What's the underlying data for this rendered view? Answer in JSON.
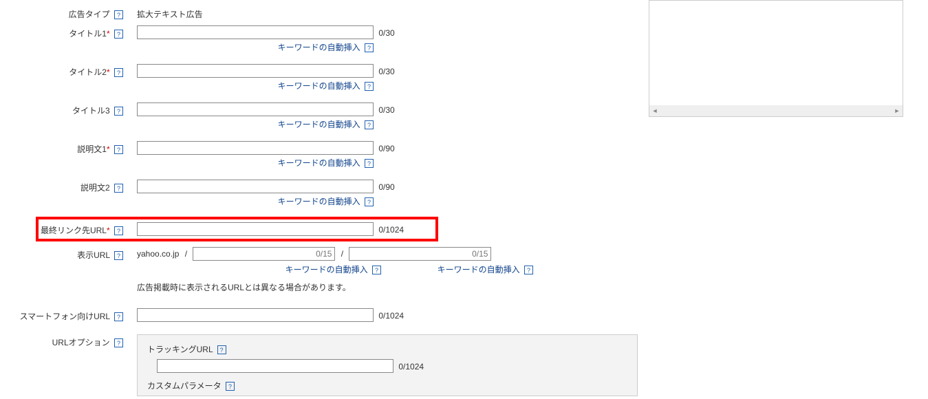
{
  "help_glyph": "?",
  "ad_type": {
    "label": "広告タイプ",
    "value": "拡大テキスト広告"
  },
  "title1": {
    "label": "タイトル1",
    "counter": "0/30",
    "kw_link": "キーワードの自動挿入"
  },
  "title2": {
    "label": "タイトル2",
    "counter": "0/30",
    "kw_link": "キーワードの自動挿入"
  },
  "title3": {
    "label": "タイトル3",
    "counter": "0/30",
    "kw_link": "キーワードの自動挿入"
  },
  "desc1": {
    "label": "説明文1",
    "counter": "0/90",
    "kw_link": "キーワードの自動挿入"
  },
  "desc2": {
    "label": "説明文2",
    "counter": "0/90",
    "kw_link": "キーワードの自動挿入"
  },
  "final_url": {
    "label": "最終リンク先URL",
    "counter": "0/1024"
  },
  "display_url": {
    "label": "表示URL",
    "domain": "yahoo.co.jp",
    "slash": "/",
    "path1_counter": "0/15",
    "path2_counter": "0/15",
    "kw_link": "キーワードの自動挿入",
    "note": "広告掲載時に表示されるURLとは異なる場合があります。"
  },
  "smartphone_url": {
    "label": "スマートフォン向けURL",
    "counter": "0/1024"
  },
  "url_options": {
    "label": "URLオプション",
    "tracking_label": "トラッキングURL",
    "tracking_counter": "0/1024",
    "custom_param_label": "カスタムパラメータ"
  },
  "scroll": {
    "left": "◄",
    "right": "►"
  }
}
